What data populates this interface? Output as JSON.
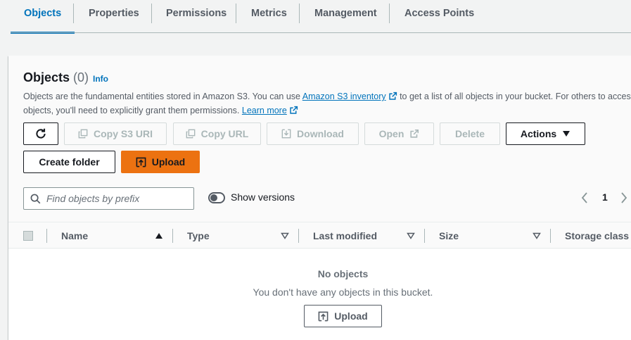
{
  "tabs": [
    {
      "label": "Objects",
      "active": true
    },
    {
      "label": "Properties",
      "active": false
    },
    {
      "label": "Permissions",
      "active": false
    },
    {
      "label": "Metrics",
      "active": false
    },
    {
      "label": "Management",
      "active": false
    },
    {
      "label": "Access Points",
      "active": false
    }
  ],
  "panel": {
    "title": "Objects",
    "count": "(0)",
    "info_label": "Info",
    "description": {
      "part1": "Objects are the fundamental entities stored in Amazon S3. You can use ",
      "link1": "Amazon S3 inventory",
      "part2": " to get a list of all objects in your bucket. For others to access your",
      "part3": "objects, you'll need to explicitly grant them permissions. ",
      "link2": "Learn more"
    }
  },
  "toolbar": {
    "refresh_icon": "refresh-icon",
    "copy_s3_uri": "Copy S3 URI",
    "copy_url": "Copy URL",
    "download": "Download",
    "open": "Open",
    "delete": "Delete",
    "actions": "Actions",
    "create_folder": "Create folder",
    "upload": "Upload"
  },
  "search": {
    "placeholder": "Find objects by prefix",
    "value": ""
  },
  "versions": {
    "label": "Show versions",
    "enabled": false
  },
  "pagination": {
    "current_page": "1"
  },
  "table": {
    "columns": [
      "Name",
      "Type",
      "Last modified",
      "Size",
      "Storage class"
    ],
    "rows": [],
    "empty_title": "No objects",
    "empty_message": "You don't have any objects in this bucket.",
    "empty_upload": "Upload"
  },
  "colors": {
    "accent": "#0073bb",
    "primary_button": "#ec7211",
    "background": "#f2f3f3"
  }
}
